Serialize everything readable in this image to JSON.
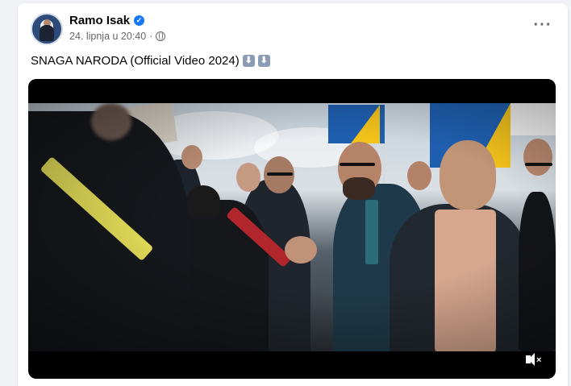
{
  "post": {
    "author": "Ramo Isak",
    "verified": true,
    "timestamp": "24. lipnja u 20:40",
    "privacy_icon": "globe-icon",
    "caption": "SNAGA NARODA (Official Video 2024)",
    "caption_emoji": [
      "down-arrow-emoji",
      "down-arrow-emoji"
    ],
    "more_icon": "more-horizontal-icon"
  },
  "video": {
    "muted": true,
    "mute_icon": "speaker-muted-icon"
  },
  "colors": {
    "verified_blue": "#1877f2",
    "secondary_text": "#65676b",
    "feed_background": "#f0f2f5"
  }
}
